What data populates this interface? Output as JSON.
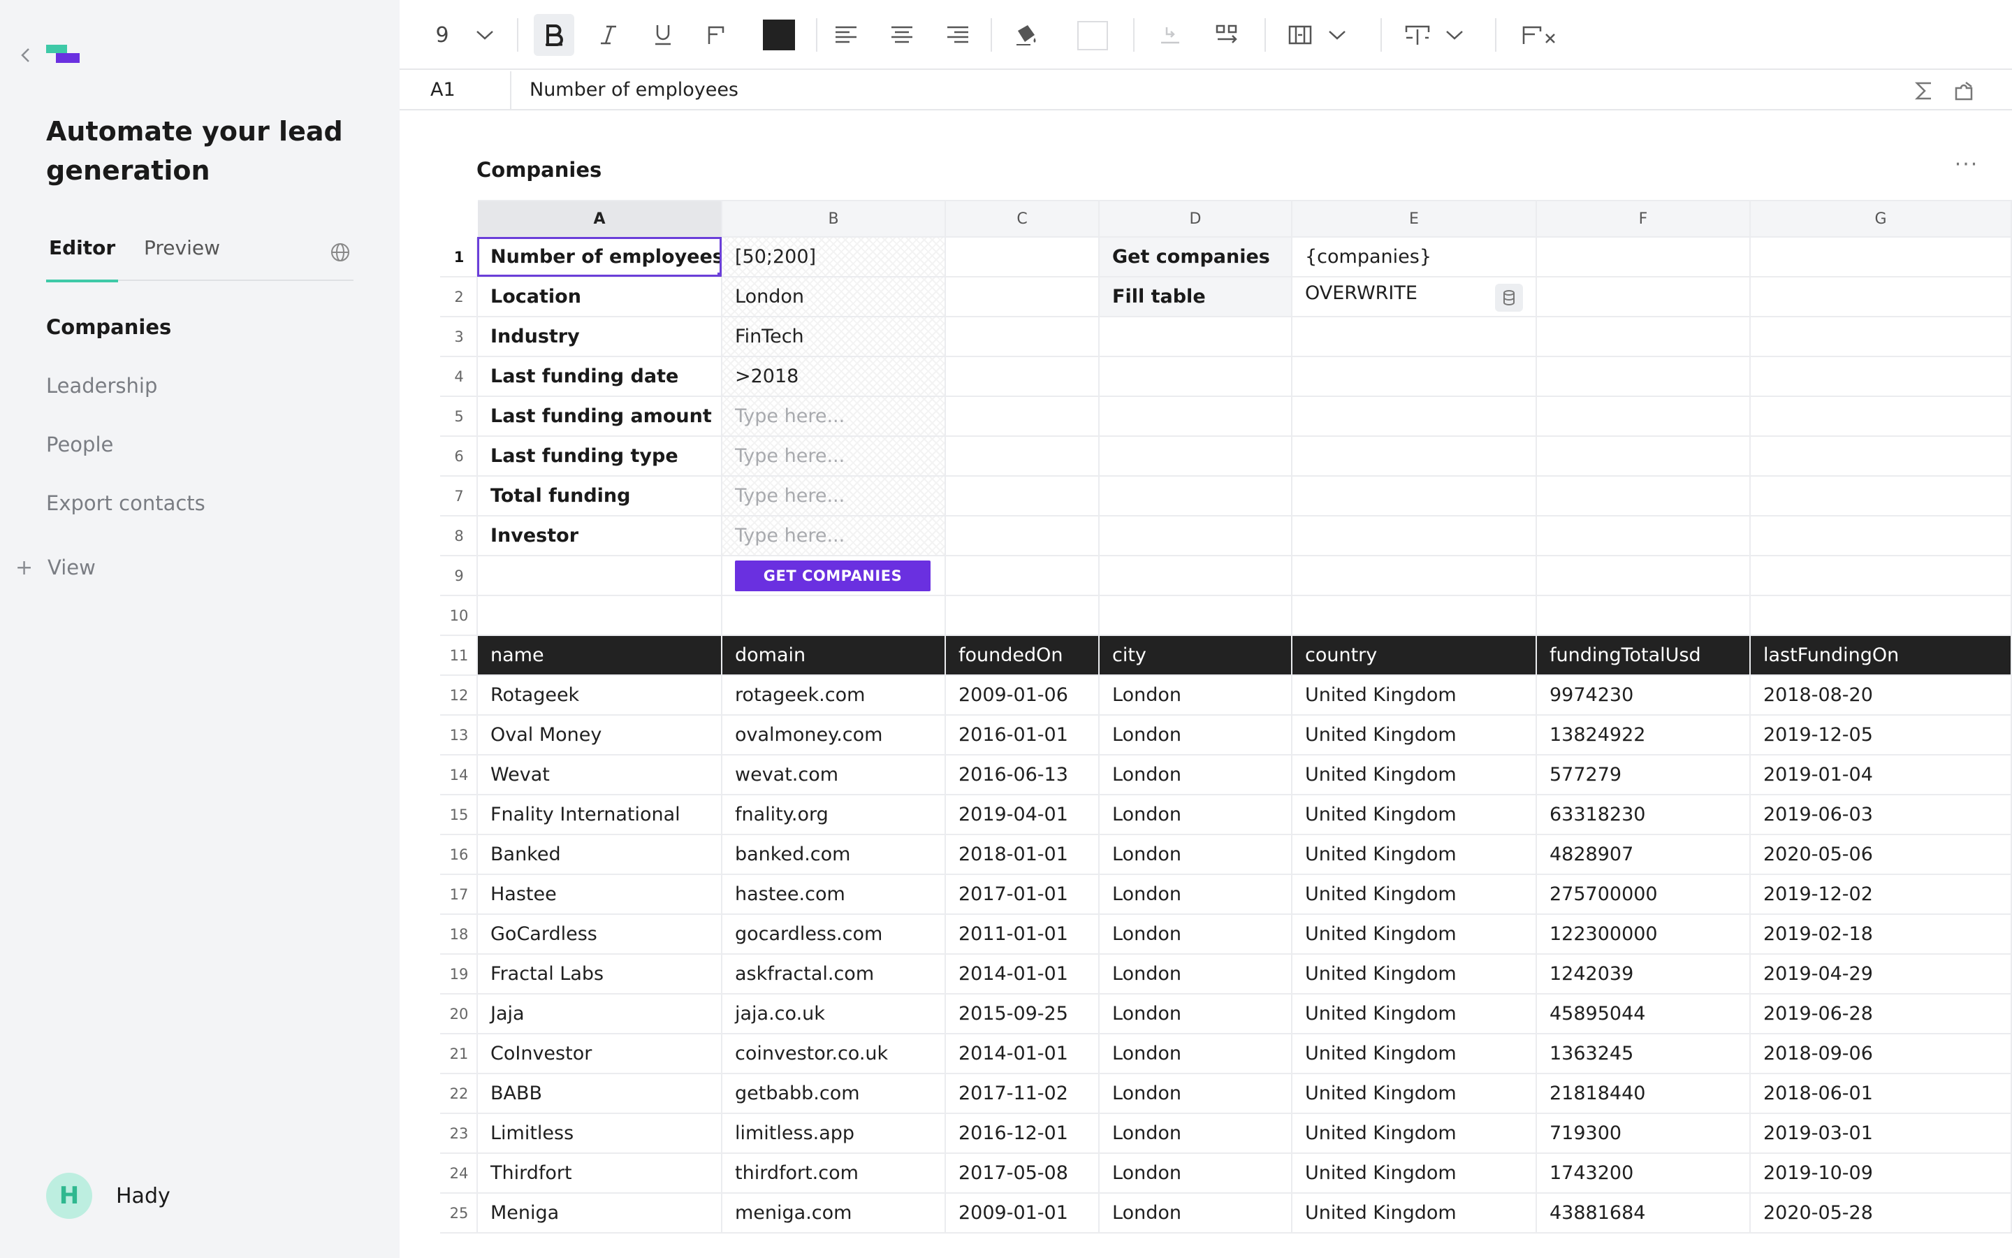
{
  "sidebar": {
    "app_title": "Automate your lead generation",
    "tabs": {
      "editor": "Editor",
      "preview": "Preview"
    },
    "nav": [
      {
        "label": "Companies",
        "active": true
      },
      {
        "label": "Leadership",
        "active": false
      },
      {
        "label": "People",
        "active": false
      },
      {
        "label": "Export contacts",
        "active": false
      }
    ],
    "add_view": {
      "icon": "+",
      "label": "View"
    },
    "user": {
      "initial": "H",
      "name": "Hady"
    }
  },
  "toolbar": {
    "font_size": "9",
    "font_color": "#222222",
    "fill_color": "#ffffff"
  },
  "formula_bar": {
    "cell_ref": "A1",
    "value": "Number of employees"
  },
  "sheet": {
    "title": "Companies",
    "menu": "···",
    "columns": [
      "A",
      "B",
      "C",
      "D",
      "E",
      "F",
      "G"
    ],
    "params": [
      {
        "label": "Number of employees",
        "value": "[50;200]",
        "placeholder": ""
      },
      {
        "label": "Location",
        "value": "London",
        "placeholder": ""
      },
      {
        "label": "Industry",
        "value": "FinTech",
        "placeholder": ""
      },
      {
        "label": "Last funding date",
        "value": ">2018",
        "placeholder": ""
      },
      {
        "label": "Last funding amount",
        "value": "",
        "placeholder": "Type here..."
      },
      {
        "label": "Last funding type",
        "value": "",
        "placeholder": "Type here..."
      },
      {
        "label": "Total funding",
        "value": "",
        "placeholder": "Type here..."
      },
      {
        "label": "Investor",
        "value": "",
        "placeholder": "Type here..."
      }
    ],
    "actions": {
      "get_companies_label": "Get companies",
      "get_companies_value": "{companies}",
      "fill_table_label": "Fill table",
      "fill_table_value": "OVERWRITE"
    },
    "cta_label": "GET COMPANIES",
    "table_headers": [
      "name",
      "domain",
      "foundedOn",
      "city",
      "country",
      "fundingTotalUsd",
      "lastFundingOn"
    ],
    "rows": [
      [
        "Rotageek",
        "rotageek.com",
        "2009-01-06",
        "London",
        "United Kingdom",
        "9974230",
        "2018-08-20"
      ],
      [
        "Oval Money",
        "ovalmoney.com",
        "2016-01-01",
        "London",
        "United Kingdom",
        "13824922",
        "2019-12-05"
      ],
      [
        "Wevat",
        "wevat.com",
        "2016-06-13",
        "London",
        "United Kingdom",
        "577279",
        "2019-01-04"
      ],
      [
        "Fnality International",
        "fnality.org",
        "2019-04-01",
        "London",
        "United Kingdom",
        "63318230",
        "2019-06-03"
      ],
      [
        "Banked",
        "banked.com",
        "2018-01-01",
        "London",
        "United Kingdom",
        "4828907",
        "2020-05-06"
      ],
      [
        "Hastee",
        "hastee.com",
        "2017-01-01",
        "London",
        "United Kingdom",
        "275700000",
        "2019-12-02"
      ],
      [
        "GoCardless",
        "gocardless.com",
        "2011-01-01",
        "London",
        "United Kingdom",
        "122300000",
        "2019-02-18"
      ],
      [
        "Fractal Labs",
        "askfractal.com",
        "2014-01-01",
        "London",
        "United Kingdom",
        "1242039",
        "2019-04-29"
      ],
      [
        "Jaja",
        "jaja.co.uk",
        "2015-09-25",
        "London",
        "United Kingdom",
        "45895044",
        "2019-06-28"
      ],
      [
        "CoInvestor",
        "coinvestor.co.uk",
        "2014-01-01",
        "London",
        "United Kingdom",
        "1363245",
        "2018-09-06"
      ],
      [
        "BABB",
        "getbabb.com",
        "2017-11-02",
        "London",
        "United Kingdom",
        "21818440",
        "2018-06-01"
      ],
      [
        "Limitless",
        "limitless.app",
        "2016-12-01",
        "London",
        "United Kingdom",
        "719300",
        "2019-03-01"
      ],
      [
        "Thirdfort",
        "thirdfort.com",
        "2017-05-08",
        "London",
        "United Kingdom",
        "1743200",
        "2019-10-09"
      ],
      [
        "Meniga",
        "meniga.com",
        "2009-01-01",
        "London",
        "United Kingdom",
        "43881684",
        "2020-05-28"
      ]
    ]
  },
  "colors": {
    "accent": "#6a30e0",
    "brand_teal": "#3ec9a7",
    "header_dark": "#222222"
  },
  "icons": {
    "back": "chevron-left-icon",
    "logo": "logo-icon",
    "globe": "globe-icon",
    "bold": "bold-icon",
    "italic": "italic-icon",
    "underline": "underline-icon",
    "sum": "sigma-icon",
    "extension": "puzzle-icon",
    "database": "database-icon"
  }
}
